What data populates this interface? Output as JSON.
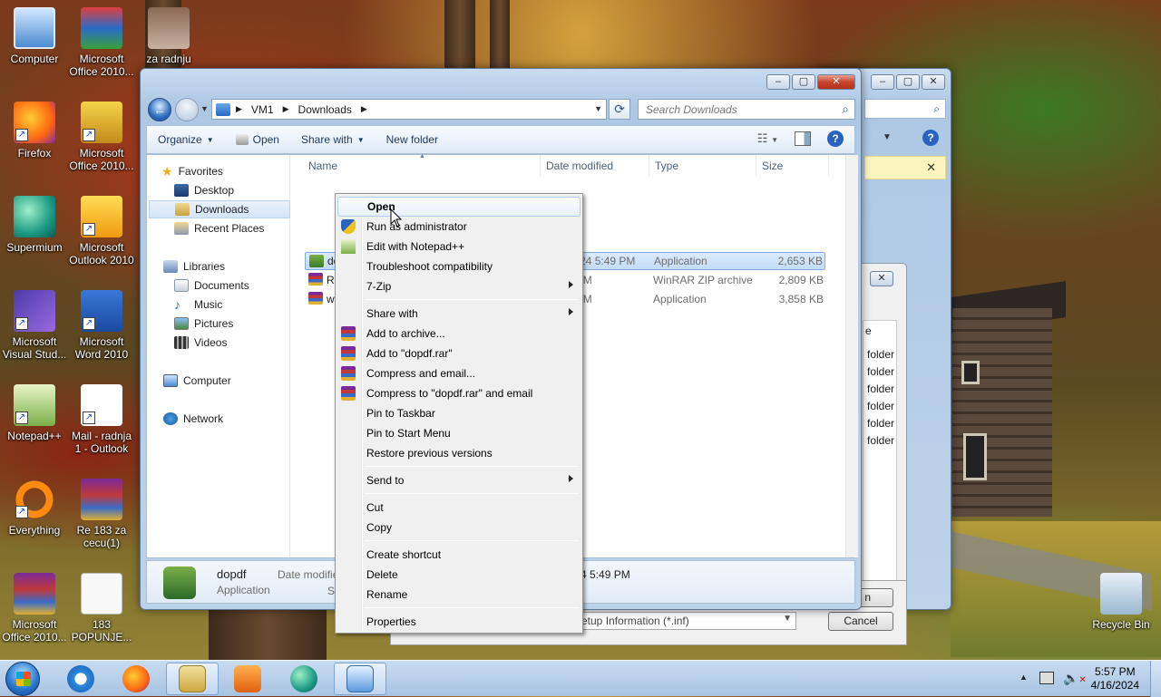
{
  "desktop": {
    "icons": [
      {
        "label": "Computer",
        "icon": "computer-icon"
      },
      {
        "label": "Microsoft Office 2010...",
        "icon": "office-icon"
      },
      {
        "label": "za radnju",
        "icon": "folder-icon"
      },
      {
        "label": "Firefox",
        "icon": "firefox-icon"
      },
      {
        "label": "Microsoft Office 2010...",
        "icon": "office-icon"
      },
      {
        "label": "Supermium",
        "icon": "supermium-icon"
      },
      {
        "label": "Microsoft Outlook 2010",
        "icon": "outlook-icon"
      },
      {
        "label": "Microsoft Visual Stud...",
        "icon": "visual-studio-icon"
      },
      {
        "label": "Microsoft Word 2010",
        "icon": "word-icon"
      },
      {
        "label": "Notepad++",
        "icon": "notepadpp-icon"
      },
      {
        "label": "Mail - radnja 1 - Outlook",
        "icon": "mail-icon"
      },
      {
        "label": "Everything",
        "icon": "everything-icon"
      },
      {
        "label": "Re 183 za cecu(1)",
        "icon": "winrar-icon"
      },
      {
        "label": "Microsoft Office 2010...",
        "icon": "winrar-icon"
      },
      {
        "label": "183 POPUNJE...",
        "icon": "document-icon"
      },
      {
        "label": "Recycle Bin",
        "icon": "recycle-bin-icon"
      }
    ]
  },
  "background_window": {
    "rows": [
      "folder",
      "folder",
      "folder",
      "folder",
      "folder",
      "folder"
    ],
    "filter_text": "etup Information (*.inf)",
    "cancel_label": "Cancel",
    "partial_button": "n",
    "partial_header": "e"
  },
  "explorer": {
    "breadcrumb": [
      "VM1",
      "Downloads"
    ],
    "search_placeholder": "Search Downloads",
    "toolbar": {
      "organize": "Organize",
      "open": "Open",
      "share_with": "Share with",
      "new_folder": "New folder"
    },
    "nav": {
      "favorites": "Favorites",
      "desktop": "Desktop",
      "downloads": "Downloads",
      "recent_places": "Recent Places",
      "libraries": "Libraries",
      "documents": "Documents",
      "music": "Music",
      "pictures": "Pictures",
      "videos": "Videos",
      "computer": "Computer",
      "network": "Network"
    },
    "columns": {
      "name": "Name",
      "date": "Date modified",
      "type": "Type",
      "size": "Size"
    },
    "files": [
      {
        "name": "dopdf",
        "date": "4/16/2024 5:49 PM",
        "type": "Application",
        "size": "2,653 KB"
      },
      {
        "name": "Re",
        "date": "4 5:24 PM",
        "type": "WinRAR ZIP archive",
        "size": "2,809 KB"
      },
      {
        "name": "w",
        "date": "4 5:06 PM",
        "type": "Application",
        "size": "3,858 KB"
      }
    ],
    "details": {
      "name": "dopdf",
      "type": "Application",
      "date_label": "Date modifie",
      "size_label": "Si",
      "date_value": "4 5:49 PM"
    }
  },
  "context_menu": {
    "items": {
      "open": "Open",
      "run_admin": "Run as administrator",
      "edit_npp": "Edit with Notepad++",
      "troubleshoot": "Troubleshoot compatibility",
      "zip7": "7-Zip",
      "share_with": "Share with",
      "add_archive": "Add to archive...",
      "add_rar": "Add to \"dopdf.rar\"",
      "compress_email": "Compress and email...",
      "compress_rar_email": "Compress to \"dopdf.rar\" and email",
      "pin_taskbar": "Pin to Taskbar",
      "pin_start": "Pin to Start Menu",
      "restore_versions": "Restore previous versions",
      "send_to": "Send to",
      "cut": "Cut",
      "copy": "Copy",
      "create_shortcut": "Create shortcut",
      "delete": "Delete",
      "rename": "Rename",
      "properties": "Properties"
    }
  },
  "taskbar": {
    "time": "5:57 PM",
    "date": "4/16/2024"
  }
}
